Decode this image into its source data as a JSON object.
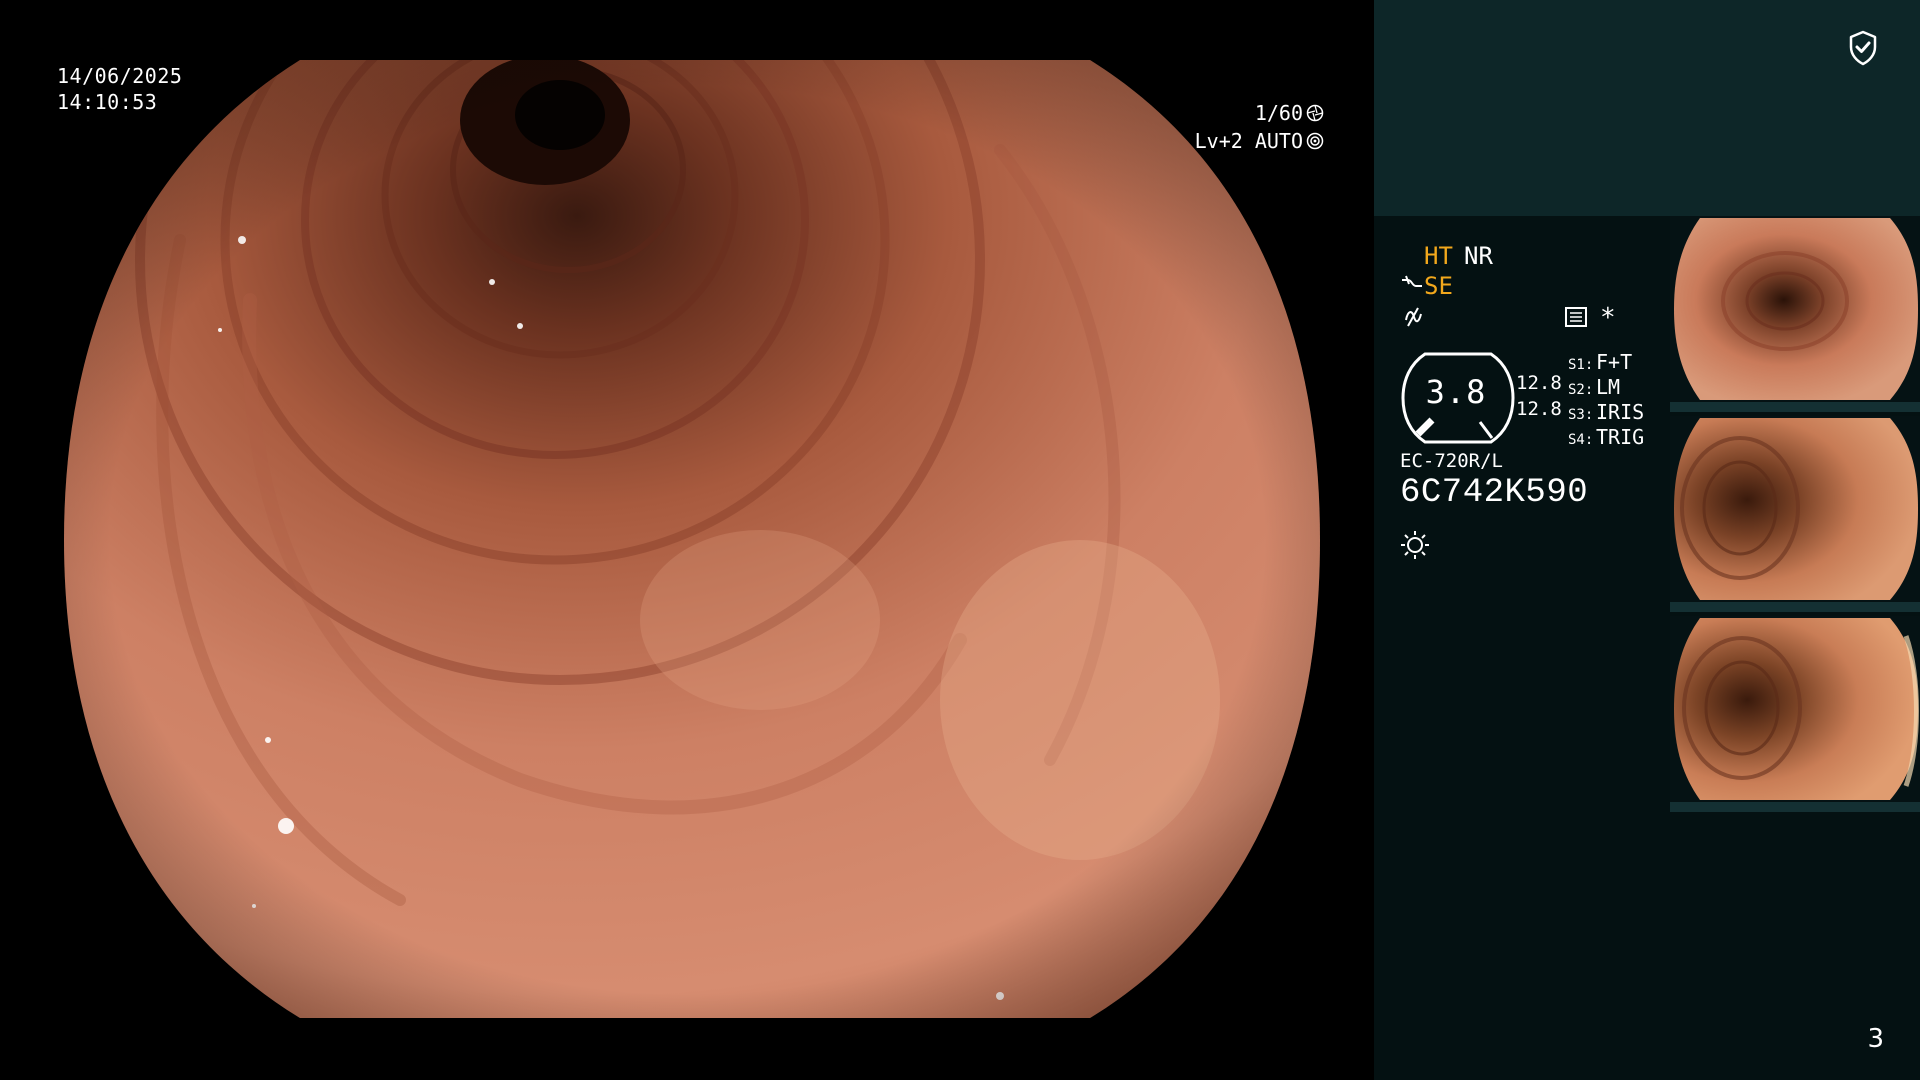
{
  "osd": {
    "date": "14/06/2025",
    "time": "14:10:53",
    "shutter": "1/60",
    "level": "Lv+2 AUTO"
  },
  "mode": {
    "ht": "HT",
    "nr": "NR",
    "se": "SE",
    "star": "*"
  },
  "enhancement": {
    "value": "3.8",
    "left_value": "12.8",
    "right_value": "12.8"
  },
  "switches": [
    {
      "key": "S1:",
      "value": "F+T"
    },
    {
      "key": "S2:",
      "value": "LM"
    },
    {
      "key": "S3:",
      "value": "IRIS"
    },
    {
      "key": "S4:",
      "value": "TRIG"
    }
  ],
  "scope": {
    "model": "EC-720R/L",
    "serial": "6C742K590"
  },
  "page": "3",
  "icons": [
    "shield-check-icon",
    "aperture-icon",
    "settings-icon",
    "scope-icon",
    "frequency-icon",
    "menu-icon",
    "light-icon"
  ],
  "colors": {
    "accent": "#f2a81c",
    "panel_top": "#0d2628",
    "panel_bottom": "#041112"
  }
}
